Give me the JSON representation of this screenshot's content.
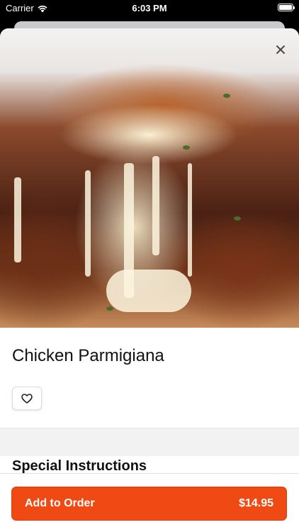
{
  "status_bar": {
    "carrier": "Carrier",
    "time": "6:03 PM",
    "icons": [
      "wifi-icon",
      "battery-icon"
    ]
  },
  "item": {
    "image_alt": "Chicken Parmigiana photo",
    "title": "Chicken Parmigiana",
    "favorite_icon": "heart-outline-icon"
  },
  "sections": {
    "special_instructions": "Special Instructions"
  },
  "order": {
    "button_label": "Add to Order",
    "price": "$14.95"
  },
  "colors": {
    "accent": "#f04a14",
    "text": "#111111",
    "divider_bg": "#f2f2f2"
  }
}
